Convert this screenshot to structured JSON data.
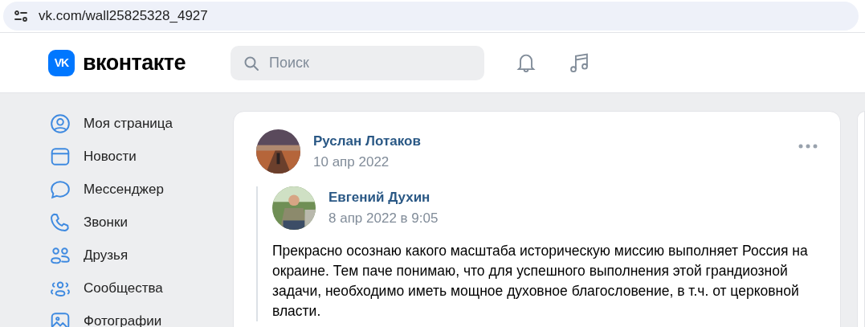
{
  "browser": {
    "url": "vk.com/wall25825328_4927"
  },
  "header": {
    "logo_mark": "VK",
    "logo_text": "вконтакте",
    "search": {
      "placeholder": "Поиск"
    }
  },
  "sidebar": {
    "items": [
      {
        "label": "Моя страница",
        "kind": "profile"
      },
      {
        "label": "Новости",
        "kind": "news"
      },
      {
        "label": "Мессенджер",
        "kind": "messenger"
      },
      {
        "label": "Звонки",
        "kind": "calls"
      },
      {
        "label": "Друзья",
        "kind": "friends"
      },
      {
        "label": "Сообщества",
        "kind": "communities"
      },
      {
        "label": "Фотографии",
        "kind": "photos"
      }
    ]
  },
  "post": {
    "author": "Руслан Лотаков",
    "date": "10 апр 2022",
    "repost": {
      "author": "Евгений Духин",
      "date": "8 апр 2022 в 9:05",
      "text": "Прекрасно осознаю какого масштаба историческую миссию выполняет Россия на окраине. Тем паче понимаю, что для успешного выполнения этой грандиозной задачи, необходимо иметь мощное духовное благословение, в т.ч. от церковной власти."
    }
  }
}
